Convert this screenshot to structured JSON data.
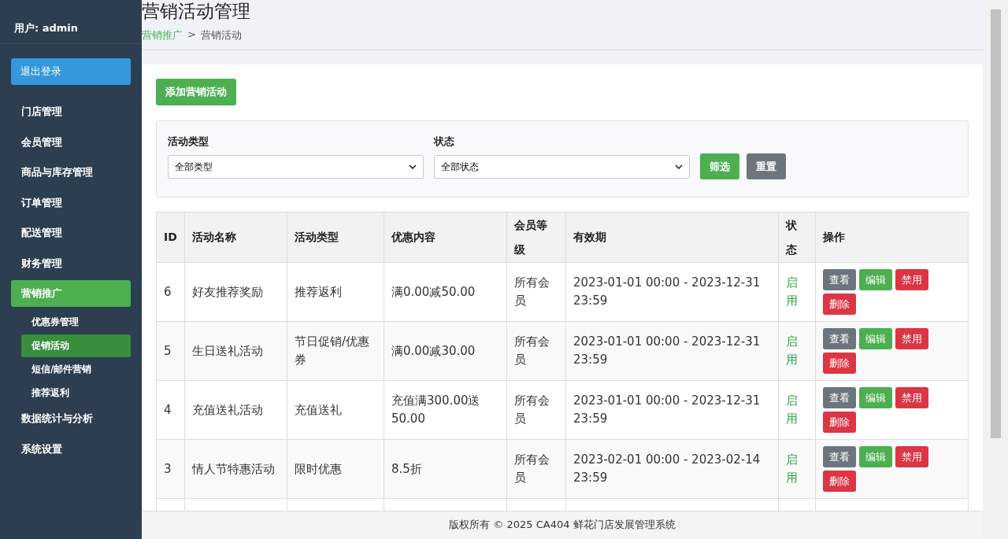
{
  "sidebar": {
    "user": "用户: admin",
    "logout": "退出登录",
    "items": [
      {
        "label": "门店管理",
        "selected": false
      },
      {
        "label": "会员管理",
        "selected": false
      },
      {
        "label": "商品与库存管理",
        "selected": false
      },
      {
        "label": "订单管理",
        "selected": false
      },
      {
        "label": "配送管理",
        "selected": false
      },
      {
        "label": "财务管理",
        "selected": false
      },
      {
        "label": "营销推广",
        "selected": true,
        "children": [
          {
            "label": "优惠券管理",
            "selected": false
          },
          {
            "label": "促销活动",
            "selected": true
          },
          {
            "label": "短信/邮件营销",
            "selected": false
          },
          {
            "label": "推荐返利",
            "selected": false
          }
        ]
      },
      {
        "label": "数据统计与分析",
        "selected": false
      },
      {
        "label": "系统设置",
        "selected": false
      }
    ]
  },
  "page": {
    "title": "营销活动管理",
    "breadcrumb": [
      {
        "label": "营销推广",
        "link": true
      },
      {
        "label": ">",
        "link": false
      },
      {
        "label": "营销活动",
        "link": false
      }
    ]
  },
  "add_button": "添加营销活动",
  "filters": {
    "fields": [
      {
        "label": "活动类型",
        "value": "全部类型"
      },
      {
        "label": "状态",
        "value": "全部状态"
      }
    ],
    "apply": "筛选",
    "reset": "重置"
  },
  "table": {
    "columns": [
      "ID",
      "活动名称",
      "活动类型",
      "优惠内容",
      "会员等级",
      "有效期",
      "状态",
      "操作"
    ],
    "rows": [
      {
        "id": "6",
        "name": "好友推荐奖励",
        "type": "推荐返利",
        "discount": "满0.00减50.00",
        "level": "所有会员",
        "period": "2023-01-01 00:00 - 2023-12-31 23:59",
        "status": "启用",
        "enabled": true,
        "actions": [
          {
            "label": "查看",
            "kind": "view"
          },
          {
            "label": "编辑",
            "kind": "edit"
          },
          {
            "label": "禁用",
            "kind": "disable"
          },
          {
            "label": "删除",
            "kind": "delete"
          }
        ]
      },
      {
        "id": "5",
        "name": "生日送礼活动",
        "type": "节日促销/优惠券",
        "discount": "满0.00减30.00",
        "level": "所有会员",
        "period": "2023-01-01 00:00 - 2023-12-31 23:59",
        "status": "启用",
        "enabled": true,
        "actions": [
          {
            "label": "查看",
            "kind": "view"
          },
          {
            "label": "编辑",
            "kind": "edit"
          },
          {
            "label": "禁用",
            "kind": "disable"
          },
          {
            "label": "删除",
            "kind": "delete"
          }
        ]
      },
      {
        "id": "4",
        "name": "充值送礼活动",
        "type": "充值送礼",
        "discount": "充值满300.00送50.00",
        "level": "所有会员",
        "period": "2023-01-01 00:00 - 2023-12-31 23:59",
        "status": "启用",
        "enabled": true,
        "actions": [
          {
            "label": "查看",
            "kind": "view"
          },
          {
            "label": "编辑",
            "kind": "edit"
          },
          {
            "label": "禁用",
            "kind": "disable"
          },
          {
            "label": "删除",
            "kind": "delete"
          }
        ]
      },
      {
        "id": "3",
        "name": "情人节特惠活动",
        "type": "限时优惠",
        "discount": "8.5折",
        "level": "所有会员",
        "period": "2023-02-01 00:00 - 2023-02-14 23:59",
        "status": "启用",
        "enabled": true,
        "actions": [
          {
            "label": "查看",
            "kind": "view"
          },
          {
            "label": "编辑",
            "kind": "edit"
          },
          {
            "label": "禁用",
            "kind": "disable"
          },
          {
            "label": "删除",
            "kind": "delete"
          }
        ]
      }
    ]
  },
  "footer": "版权所有 © 2025 CA404 鲜花门店发展管理系统"
}
